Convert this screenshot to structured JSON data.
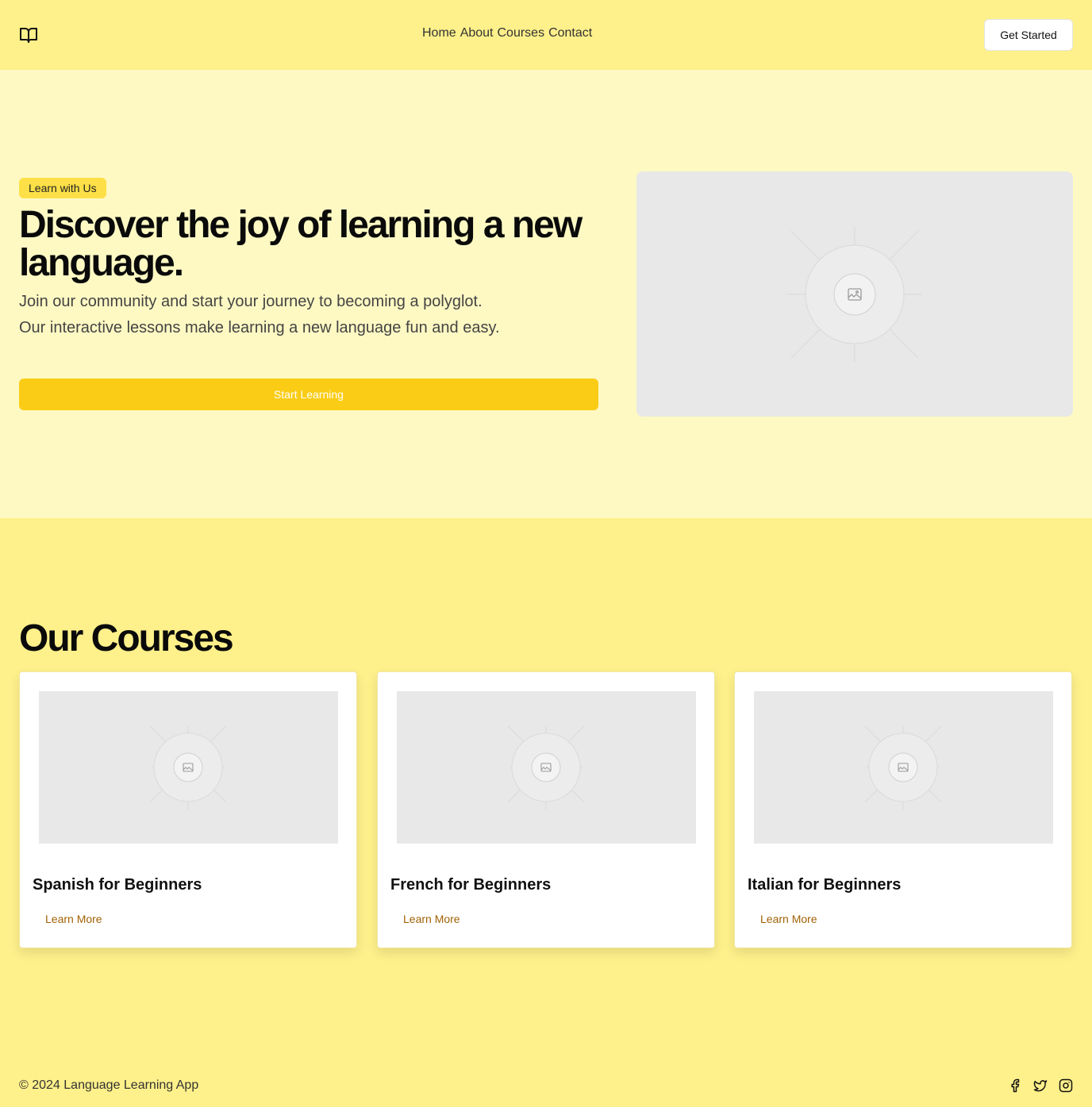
{
  "header": {
    "logo_icon": "book-open-icon",
    "nav": [
      "Home",
      "About",
      "Courses",
      "Contact"
    ],
    "cta_label": "Get Started"
  },
  "hero": {
    "badge": "Learn with Us",
    "title": "Discover the joy of learning a new language.",
    "description": "Join our community and start your journey to becoming a polyglot. Our interactive lessons make learning a new language fun and easy.",
    "cta_label": "Start Learning",
    "image_icon": "image-placeholder-icon"
  },
  "courses": {
    "title": "Our Courses",
    "items": [
      {
        "title": "Spanish for Beginners",
        "link_label": "Learn More"
      },
      {
        "title": "French for Beginners",
        "link_label": "Learn More"
      },
      {
        "title": "Italian for Beginners",
        "link_label": "Learn More"
      }
    ]
  },
  "footer": {
    "copyright": "© 2024 Language Learning App",
    "social_icons": [
      "facebook-icon",
      "twitter-icon",
      "instagram-icon"
    ]
  },
  "colors": {
    "header_bg": "#fef08a",
    "hero_bg": "#fef9c3",
    "accent": "#facc15",
    "badge_bg": "#fde047",
    "link": "#a16207",
    "placeholder_bg": "#e8e8e8"
  }
}
